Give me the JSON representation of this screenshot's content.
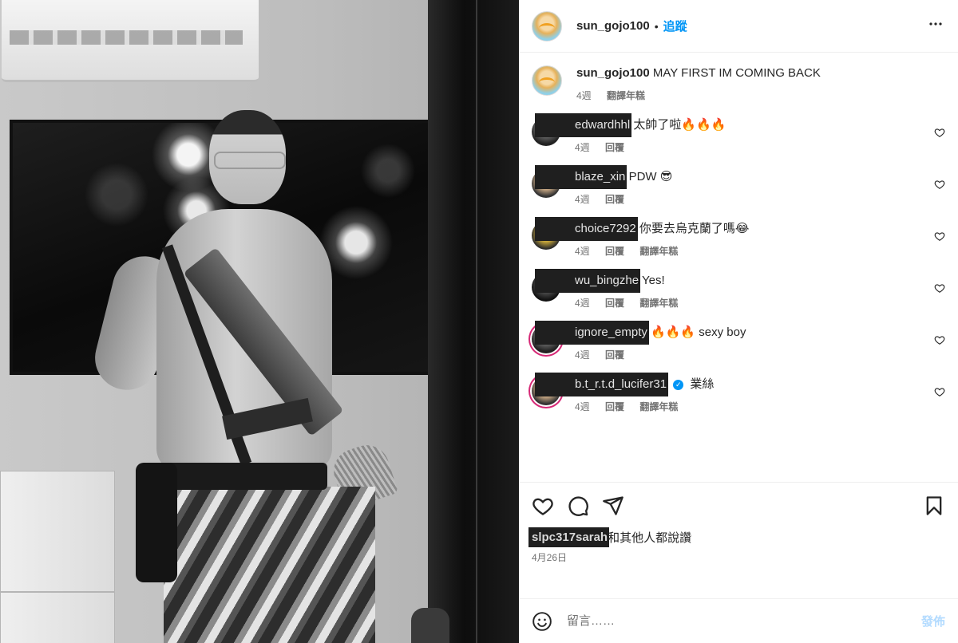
{
  "post": {
    "author": "sun_gojo100",
    "separator": "•",
    "follow_label": "追蹤",
    "more_label": "•••"
  },
  "caption": {
    "username": "sun_gojo100",
    "text": "MAY FIRST IM COMING BACK",
    "time": "4週",
    "translate": "翻譯年糕"
  },
  "comments": [
    {
      "username": "edwardhhl",
      "text": "太帥了啦🔥🔥🔥",
      "time": "4週",
      "reply": "回覆",
      "translate": "",
      "verified": false
    },
    {
      "username": "blaze_xin",
      "text": "PDW 😎",
      "time": "4週",
      "reply": "回覆",
      "translate": "",
      "verified": false
    },
    {
      "username": "choice7292",
      "text": "你要去烏克蘭了嗎😂",
      "time": "4週",
      "reply": "回覆",
      "translate": "翻譯年糕",
      "verified": false
    },
    {
      "username": "wu_bingzhe",
      "text": "Yes!",
      "time": "4週",
      "reply": "回覆",
      "translate": "翻譯年糕",
      "verified": false
    },
    {
      "username": "ignore_empty",
      "text": "🔥🔥🔥 sexy boy",
      "time": "4週",
      "reply": "回覆",
      "translate": "",
      "verified": false
    },
    {
      "username": "b.t_r.t.d_lucifer31",
      "text": "業絲",
      "time": "4週",
      "reply": "回覆",
      "translate": "翻譯年糕",
      "verified": true
    }
  ],
  "likes": {
    "first_user": "slpc317sarah",
    "rest": "和其他人都說讚"
  },
  "date": "4月26日",
  "composer": {
    "placeholder": "留言……",
    "post_label": "發佈"
  },
  "icons": {
    "like": "heart-icon",
    "comment": "comment-icon",
    "share": "paper-plane-icon",
    "save": "bookmark-icon",
    "emoji": "smiley-icon",
    "more": "ellipsis-icon"
  },
  "colors": {
    "link_blue": "#0095f6",
    "post_button_disabled": "#b3dbff",
    "secondary_text": "#737373",
    "divider": "#efefef"
  }
}
